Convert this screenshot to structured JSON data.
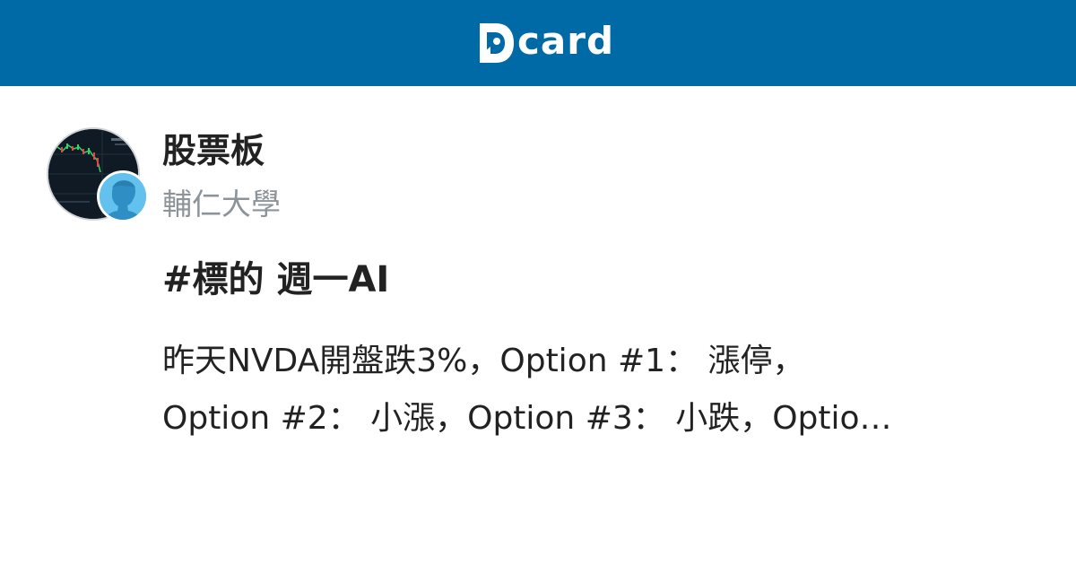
{
  "header": {
    "brand_text": "card",
    "brand_color": "#006aa6"
  },
  "post": {
    "forum": "股票板",
    "school": "輔仁大學",
    "title": "#標的 週一AI",
    "excerpt_line1": "昨天NVDA開盤跌3%，Option #1： 漲停，",
    "excerpt_line2": "Option #2： 小漲，Option #3： 小跌，Optio…"
  },
  "icons": {
    "logo": "dcard-logo-icon",
    "forum_avatar": "stock-chart-avatar",
    "user_avatar": "person-silhouette-icon"
  }
}
